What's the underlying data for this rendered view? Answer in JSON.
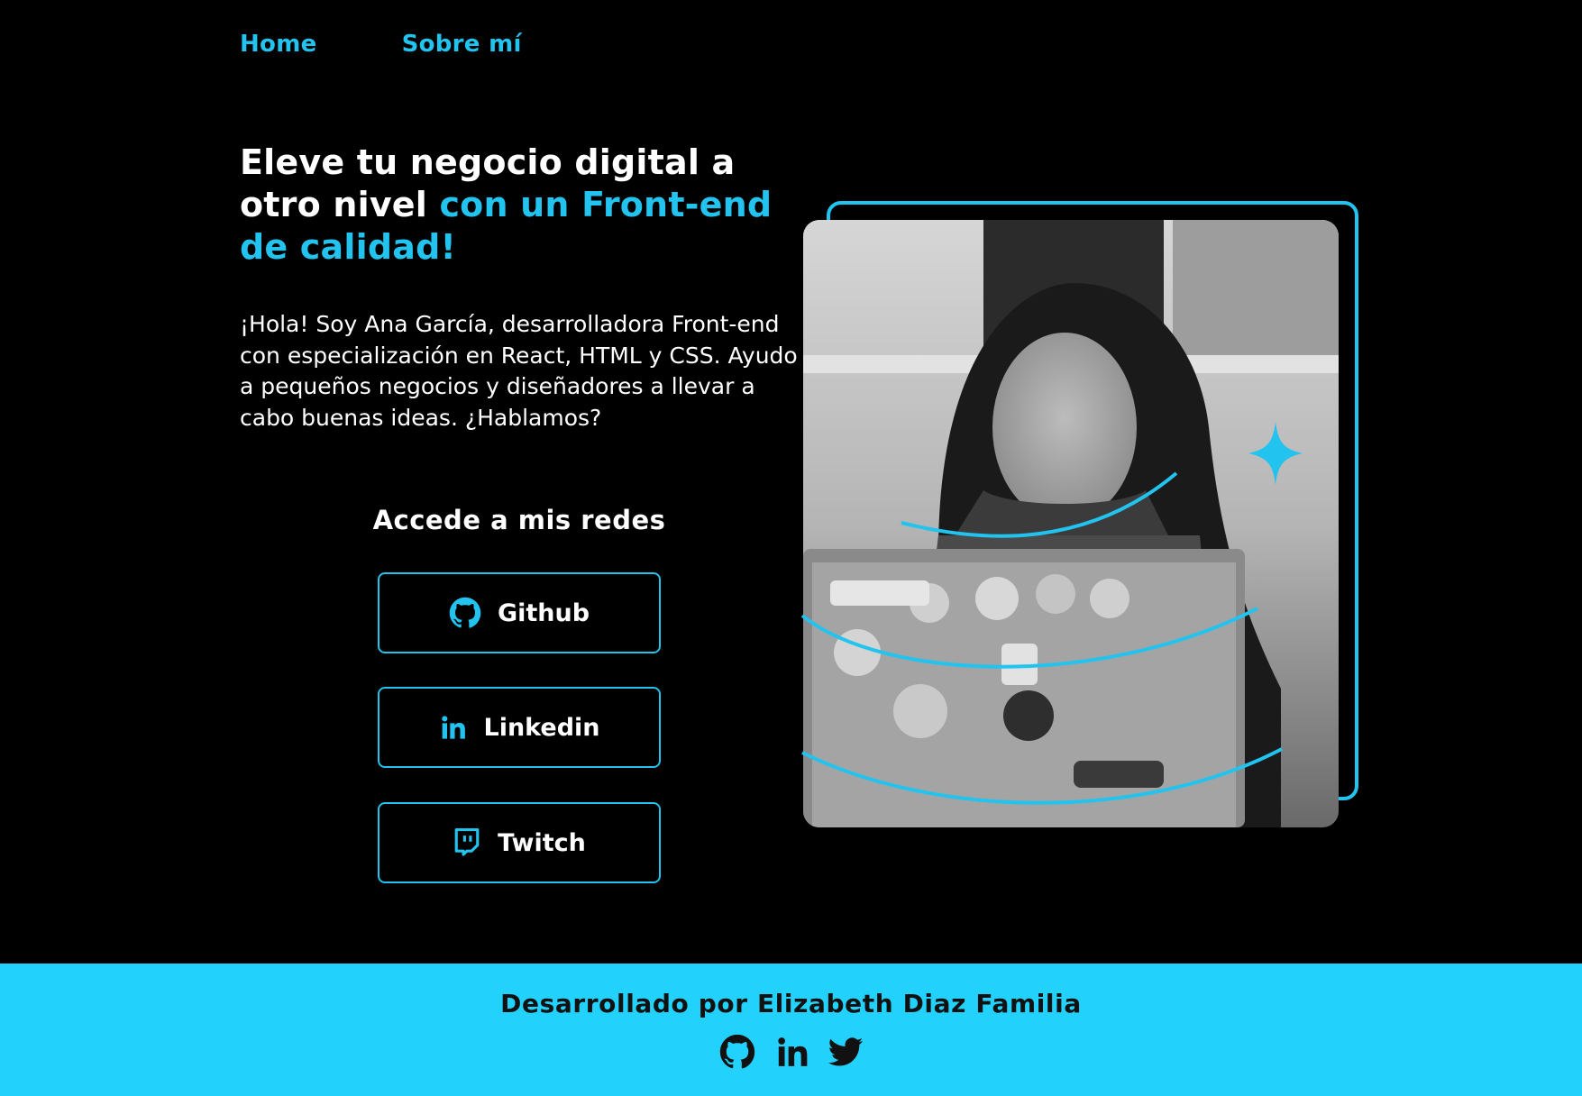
{
  "nav": {
    "home": "Home",
    "about": "Sobre mí"
  },
  "hero": {
    "title_white": "Eleve tu negocio digital a otro nivel ",
    "title_accent": "con un Front-end de calidad!",
    "intro": "¡Hola! Soy Ana García, desarrolladora Front-end con especialización en React, HTML y CSS. Ayudo a pequeños negocios y diseñadores a llevar a cabo buenas ideas. ¿Hablamos?"
  },
  "social": {
    "heading": "Accede a mis redes",
    "buttons": [
      {
        "label": "Github",
        "icon": "github-icon"
      },
      {
        "label": "Linkedin",
        "icon": "linkedin-icon"
      },
      {
        "label": "Twitch",
        "icon": "twitch-icon"
      }
    ]
  },
  "footer": {
    "text": "Desarrollado por Elizabeth Diaz Familia",
    "icons": [
      "github-icon",
      "linkedin-icon",
      "twitter-icon"
    ]
  },
  "colors": {
    "accent": "#22c4ef",
    "footer_bg": "#22d2fd",
    "background": "#000000"
  }
}
